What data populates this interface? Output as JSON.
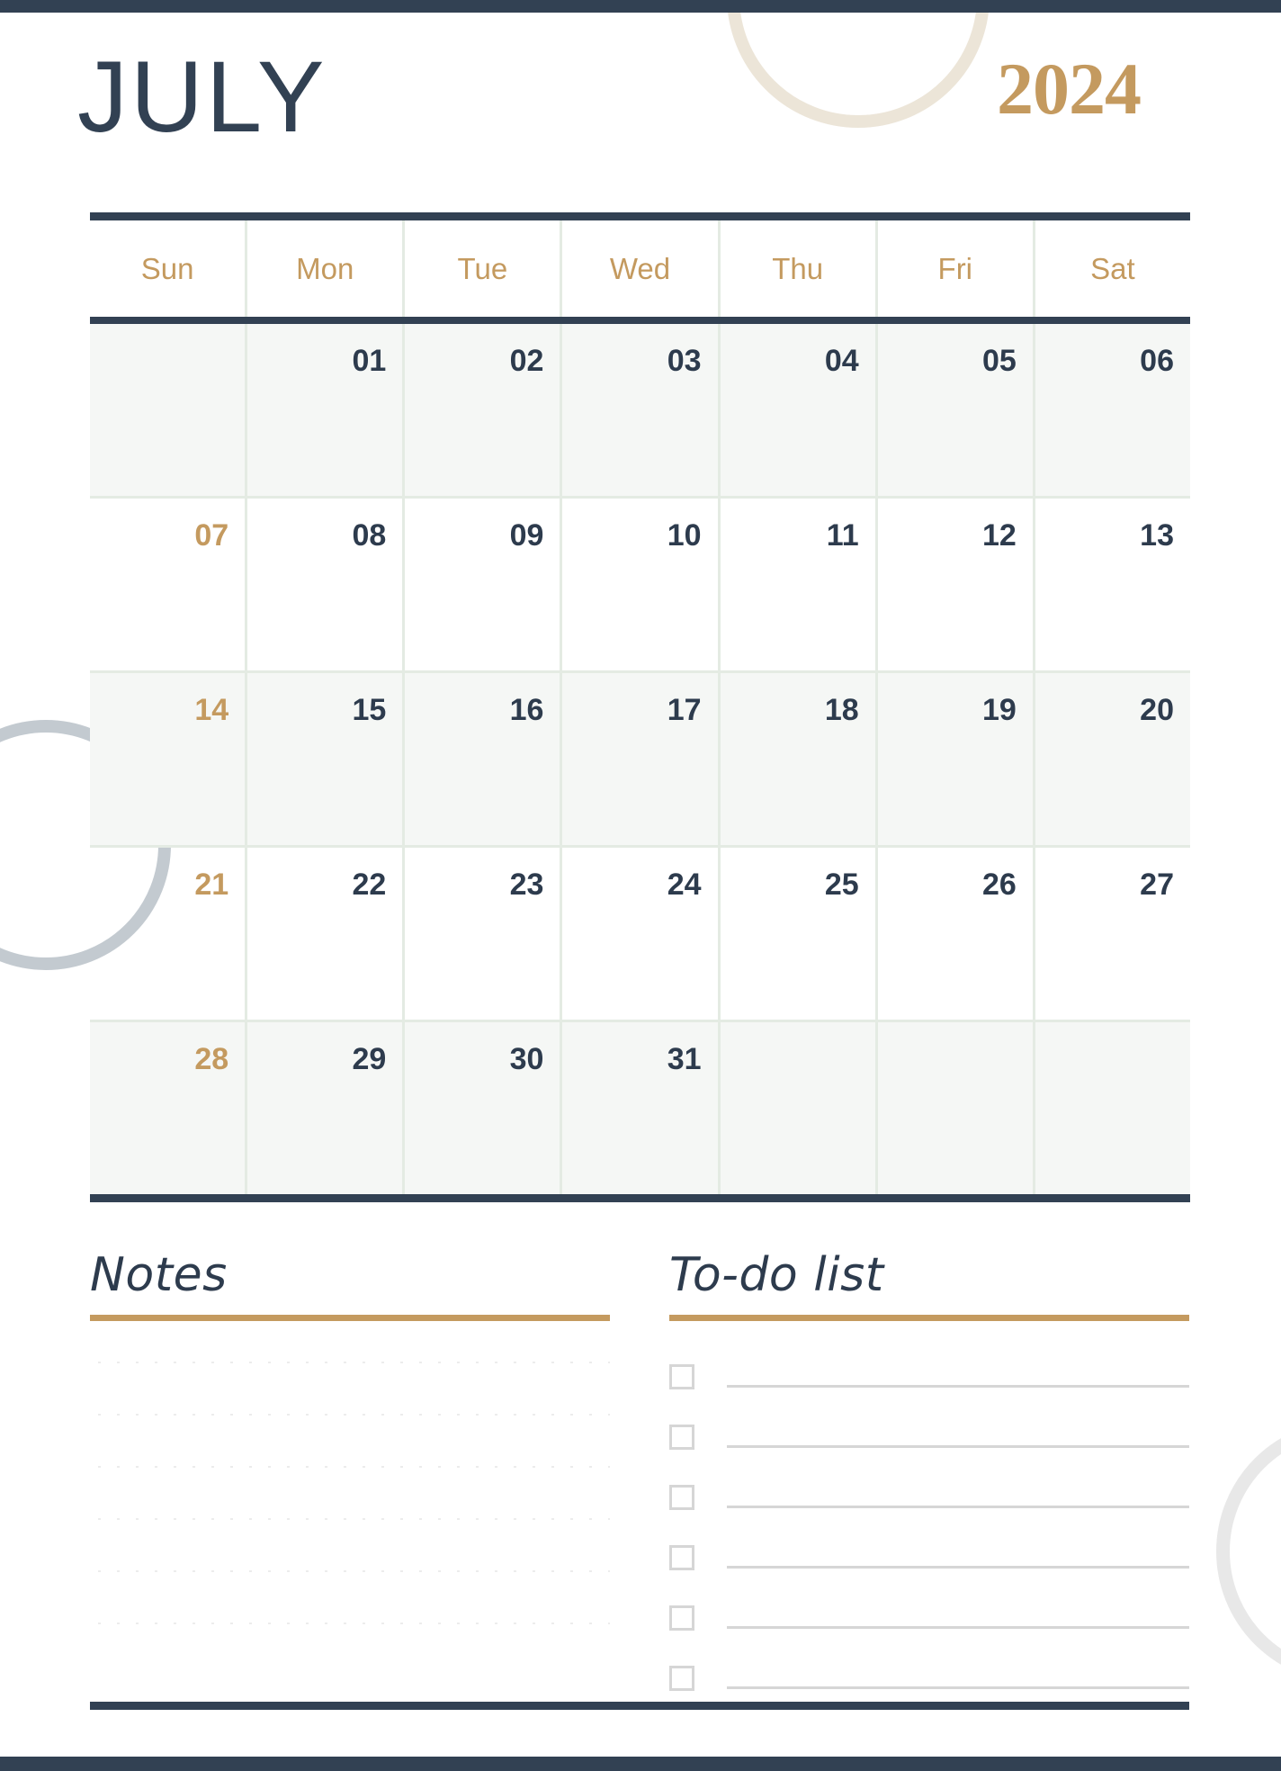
{
  "page": {
    "month": "JULY",
    "year": "2024",
    "accent_gold": "#c49a5f",
    "accent_navy": "#324153",
    "grid_line": "#e4ebe3",
    "row_shade": "#f5f7f5"
  },
  "calendar": {
    "weekdays": [
      "Sun",
      "Mon",
      "Tue",
      "Wed",
      "Thu",
      "Fri",
      "Sat"
    ],
    "weeks": [
      [
        "",
        "01",
        "02",
        "03",
        "04",
        "05",
        "06"
      ],
      [
        "07",
        "08",
        "09",
        "10",
        "11",
        "12",
        "13"
      ],
      [
        "14",
        "15",
        "16",
        "17",
        "18",
        "19",
        "20"
      ],
      [
        "21",
        "22",
        "23",
        "24",
        "25",
        "26",
        "27"
      ],
      [
        "28",
        "29",
        "30",
        "31",
        "",
        "",
        ""
      ]
    ]
  },
  "notes": {
    "title": "Notes",
    "line_count": 6
  },
  "todo": {
    "title": "To-do list",
    "item_count": 6
  }
}
